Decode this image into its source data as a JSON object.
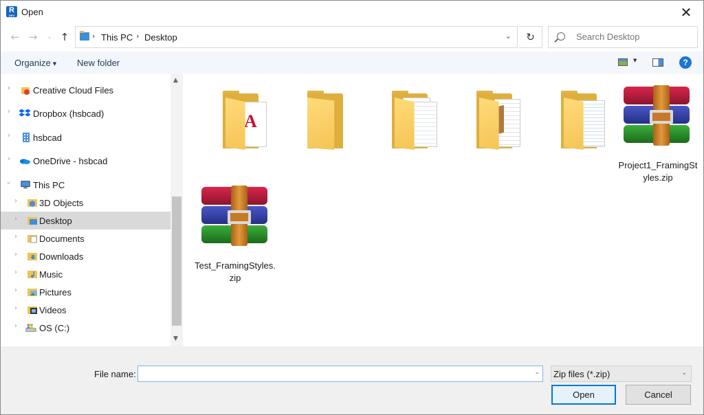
{
  "window": {
    "title": "Open",
    "app_icon_letter": "R",
    "app_icon_sub": "DEV"
  },
  "nav": {
    "breadcrumbs": [
      "This PC",
      "Desktop"
    ],
    "search_placeholder": "Search Desktop"
  },
  "commands": {
    "organize": "Organize",
    "new_folder": "New folder"
  },
  "tree": [
    {
      "label": "Creative Cloud Files",
      "icon": "creative-cloud-icon"
    },
    {
      "label": "Dropbox (hsbcad)",
      "icon": "dropbox-icon"
    },
    {
      "label": "hsbcad",
      "icon": "building-icon"
    },
    {
      "label": "OneDrive - hsbcad",
      "icon": "onedrive-icon"
    },
    {
      "label": "This PC",
      "icon": "computer-icon"
    },
    {
      "label": "3D Objects",
      "icon": "3d-objects-icon"
    },
    {
      "label": "Desktop",
      "icon": "desktop-icon",
      "selected": true
    },
    {
      "label": "Documents",
      "icon": "documents-icon"
    },
    {
      "label": "Downloads",
      "icon": "downloads-icon"
    },
    {
      "label": "Music",
      "icon": "music-icon"
    },
    {
      "label": "Pictures",
      "icon": "pictures-icon"
    },
    {
      "label": "Videos",
      "icon": "videos-icon"
    },
    {
      "label": "OS (C:)",
      "icon": "drive-icon"
    }
  ],
  "files": [
    {
      "name": "",
      "type": "folder-pdf"
    },
    {
      "name": "",
      "type": "folder"
    },
    {
      "name": "",
      "type": "folder-docs"
    },
    {
      "name": "",
      "type": "folder-box"
    },
    {
      "name": "",
      "type": "folder-sheets"
    },
    {
      "name": "Project1_FramingStyles.zip",
      "type": "zip"
    },
    {
      "name": "Test_FramingStyles.zip",
      "type": "zip"
    }
  ],
  "footer": {
    "file_name_label": "File name:",
    "file_name_value": "",
    "filter": "Zip files (*.zip)",
    "open_label": "Open",
    "cancel_label": "Cancel"
  }
}
